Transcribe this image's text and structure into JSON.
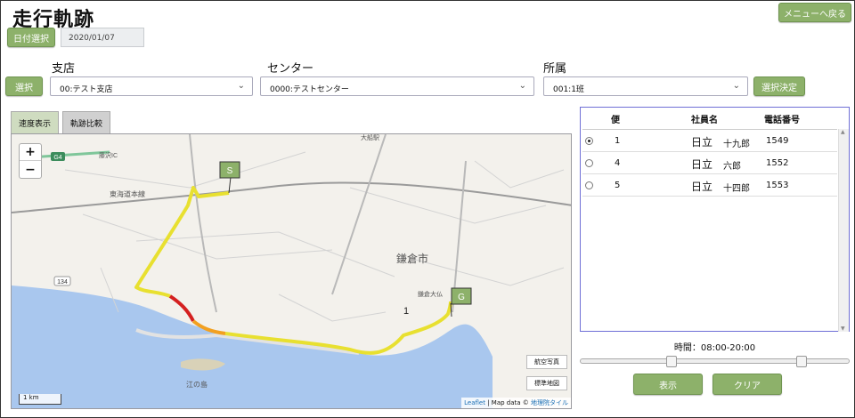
{
  "page_title": "走行軌跡",
  "header": {
    "menu_label": "メニューへ戻る"
  },
  "date": {
    "button_label": "日付選択",
    "value": "2020/01/07"
  },
  "filters": {
    "select_button": "選択",
    "branch": {
      "label": "支店",
      "value": "00:テスト支店"
    },
    "center": {
      "label": "センター",
      "value": "0000:テストセンター"
    },
    "dept": {
      "label": "所属",
      "value": "001:1班"
    },
    "decide_button": "選択決定"
  },
  "tabs": [
    {
      "label": "速度表示"
    },
    {
      "label": "軌跡比較"
    }
  ],
  "map": {
    "zoom_in": "+",
    "zoom_out": "−",
    "start_marker": "S",
    "goal_marker": "G",
    "route_number": "1",
    "labels": {
      "city": "鎌倉市",
      "line": "東海道本線",
      "station1": "鎌倉大仏",
      "place1": "大船駅",
      "place2": "藤沢IC",
      "island": "江の島",
      "road": "G4",
      "hotel": "134"
    },
    "aerial_button": "航空写真",
    "standard_button": "標準地図",
    "scale": "1 km",
    "attribution_leaflet": "Leaflet",
    "attribution_text": " | Map data © ",
    "attribution_link": "地理院タイル"
  },
  "panel": {
    "headers": {
      "bin": "便",
      "employee": "社員名",
      "phone": "電話番号"
    },
    "rows": [
      {
        "selected": true,
        "bin": "1",
        "last": "日立",
        "first": "十九郎",
        "phone": "1549"
      },
      {
        "selected": false,
        "bin": "4",
        "last": "日立",
        "first": "六郎",
        "phone": "1552"
      },
      {
        "selected": false,
        "bin": "5",
        "last": "日立",
        "first": "十四郎",
        "phone": "1553"
      }
    ]
  },
  "time": {
    "label": "時間：08:00-20:00",
    "range_start": 0.33,
    "range_end": 0.83
  },
  "actions": {
    "show": "表示",
    "clear": "クリア"
  },
  "colors": {
    "accent": "#8db16a",
    "panel_border": "#6f6fd6",
    "sea": "#a9c7ee",
    "route_slow": "#d42020",
    "route_mid": "#f2a020",
    "route_fast": "#e8e030"
  }
}
